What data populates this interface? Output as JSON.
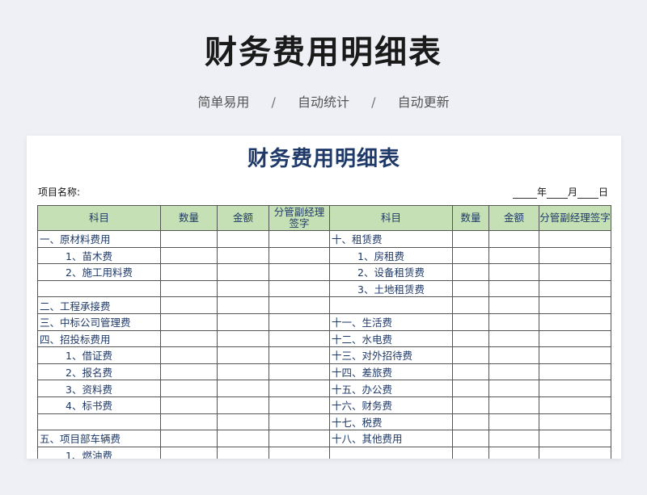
{
  "header": {
    "title": "财务费用明细表",
    "tags": [
      "简单易用",
      "自动统计",
      "自动更新"
    ],
    "separator": "/"
  },
  "sheet": {
    "title": "财务费用明细表",
    "project_label": "项目名称:",
    "date": {
      "year": "年",
      "month": "月",
      "day": "日"
    },
    "columns": [
      "科目",
      "数量",
      "金额",
      "分管副经理签字",
      "科目",
      "数量",
      "金额",
      "分管副经理签字"
    ],
    "rows": [
      {
        "left": "一、原材料费用",
        "left_sub": false,
        "right": "十、租赁费",
        "right_sub": false
      },
      {
        "left": "1、苗木费",
        "left_sub": true,
        "right": "1、房租费",
        "right_sub": true
      },
      {
        "left": "2、施工用料费",
        "left_sub": true,
        "right": "2、设备租赁费",
        "right_sub": true
      },
      {
        "left": "",
        "left_sub": false,
        "right": "3、土地租赁费",
        "right_sub": true
      },
      {
        "left": "二、工程承接费",
        "left_sub": false,
        "right": "",
        "right_sub": false
      },
      {
        "left": "三、中标公司管理费",
        "left_sub": false,
        "right": "十一、生活费",
        "right_sub": false
      },
      {
        "left": "四、招投标费用",
        "left_sub": false,
        "right": "十二、水电费",
        "right_sub": false
      },
      {
        "left": "1、借证费",
        "left_sub": true,
        "right": "十三、对外招待费",
        "right_sub": false
      },
      {
        "left": "2、报名费",
        "left_sub": true,
        "right": "十四、差旅费",
        "right_sub": false
      },
      {
        "left": "3、资料费",
        "left_sub": true,
        "right": "十五、办公费",
        "right_sub": false
      },
      {
        "left": "4、标书费",
        "left_sub": true,
        "right": "十六、财务费",
        "right_sub": false
      },
      {
        "left": "",
        "left_sub": false,
        "right": "十七、税费",
        "right_sub": false
      },
      {
        "left": "五、项目部车辆费",
        "left_sub": false,
        "right": "十八、其他费用",
        "right_sub": false
      },
      {
        "left": "1、燃油费",
        "left_sub": true,
        "right": "",
        "right_sub": false
      }
    ]
  }
}
